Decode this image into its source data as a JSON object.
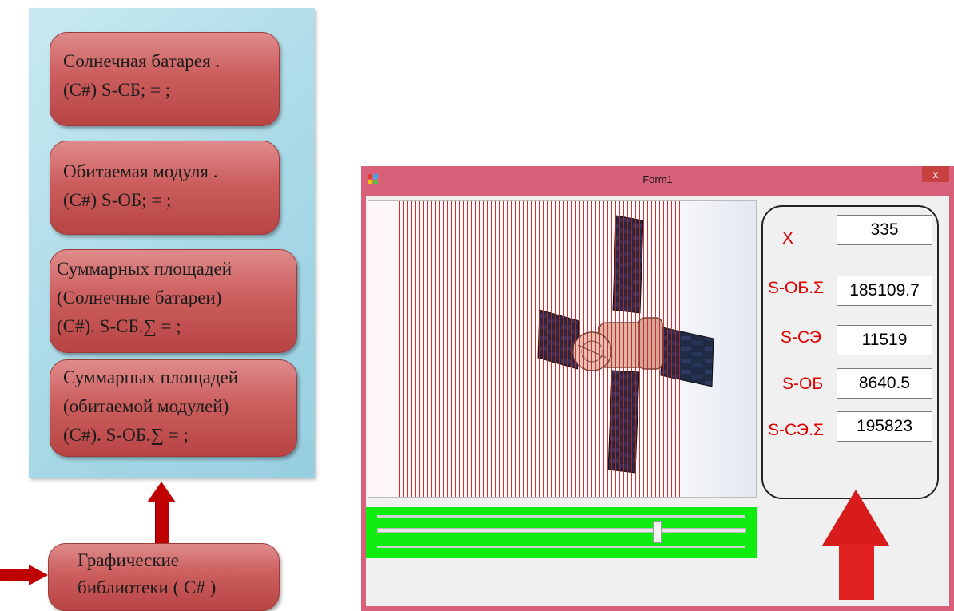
{
  "diagram": {
    "nodes": [
      {
        "line1": "Солнечная батарея .",
        "line2": "(C#)  S-СБ; = ;"
      },
      {
        "line1": "Обитаемая модуля .",
        "line2": "(C#)  S-ОБ; = ;"
      },
      {
        "line1": "Суммарных площадей",
        "line2": "(Солнечные батареи)",
        "line3": "(C#). S-СБ.∑ = ;"
      },
      {
        "line1": "Суммарных площадей",
        "line2": "(обитаемой модулей)",
        "line3": "(C#). S-ОБ.∑ = ;"
      }
    ],
    "source_node": {
      "line1": "Графические",
      "line2": "библиотеки ( C# )"
    },
    "colors": {
      "panel": "#a9d9e7",
      "node": "#c65454",
      "arrow": "#c00000"
    }
  },
  "window": {
    "title": "Form1",
    "close_label": "x",
    "colors": {
      "frame": "#d86078",
      "slider_bg": "#0fec0f",
      "label_red": "#e00000"
    },
    "slider": {
      "value_fraction": 0.76
    },
    "fields": [
      {
        "label": "X",
        "value": "335"
      },
      {
        "label": "S-ОБ.Σ",
        "value": "185109.7"
      },
      {
        "label": "S-СЭ",
        "value": "11519"
      },
      {
        "label": "S-ОБ",
        "value": "8640.5"
      },
      {
        "label": "S-СЭ.Σ",
        "value": "195823"
      }
    ]
  }
}
